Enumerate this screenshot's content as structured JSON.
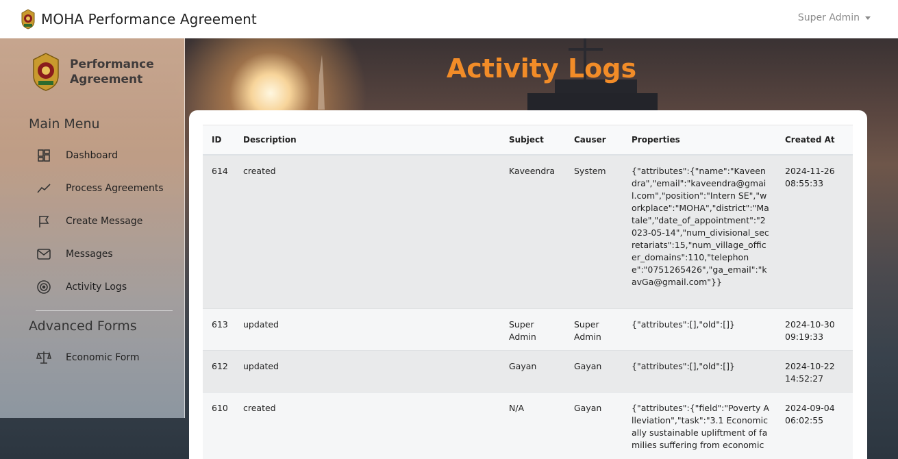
{
  "header": {
    "title": "MOHA Performance Agreement",
    "user": "Super Admin"
  },
  "sidebar": {
    "brand_line1": "Performance",
    "brand_line2": "Agreement",
    "main_menu_heading": "Main Menu",
    "items": [
      {
        "label": "Dashboard",
        "icon": "dashboard-icon"
      },
      {
        "label": "Process Agreements",
        "icon": "trend-line-icon"
      },
      {
        "label": "Create Message",
        "icon": "flag-icon"
      },
      {
        "label": "Messages",
        "icon": "mail-icon"
      },
      {
        "label": "Activity Logs",
        "icon": "target-icon"
      }
    ],
    "advanced_heading": "Advanced Forms",
    "advanced_items": [
      {
        "label": "Economic Form",
        "icon": "scale-icon"
      }
    ]
  },
  "page": {
    "title": "Activity Logs"
  },
  "table": {
    "columns": [
      "ID",
      "Description",
      "Subject",
      "Causer",
      "Properties",
      "Created At"
    ],
    "rows": [
      {
        "id": "614",
        "description": "created",
        "subject": "Kaveendra",
        "causer": "System",
        "properties": "{\"attributes\":{\"name\":\"Kaveendra\",\"email\":\"kaveendra@gmail.com\",\"position\":\"Intern SE\",\"workplace\":\"MOHA\",\"district\":\"Matale\",\"date_of_appointment\":\"2023-05-14\",\"num_divisional_secretariats\":15,\"num_village_officer_domains\":110,\"telephone\":\"0751265426\",\"ga_email\":\"kavGa@gmail.com\"}}",
        "created_at": "2024-11-26 08:55:33"
      },
      {
        "id": "613",
        "description": "updated",
        "subject": "Super Admin",
        "causer": "Super Admin",
        "properties": "{\"attributes\":[],\"old\":[]}",
        "created_at": "2024-10-30 09:19:33"
      },
      {
        "id": "612",
        "description": "updated",
        "subject": "Gayan",
        "causer": "Gayan",
        "properties": "{\"attributes\":[],\"old\":[]}",
        "created_at": "2024-10-22 14:52:27"
      },
      {
        "id": "610",
        "description": "created",
        "subject": "N/A",
        "causer": "Gayan",
        "properties": "{\"attributes\":{\"field\":\"Poverty Alleviation\",\"task\":\"3.1 Economically sustainable upliftment of families suffering from economic",
        "created_at": "2024-09-04 06:02:55"
      }
    ]
  }
}
